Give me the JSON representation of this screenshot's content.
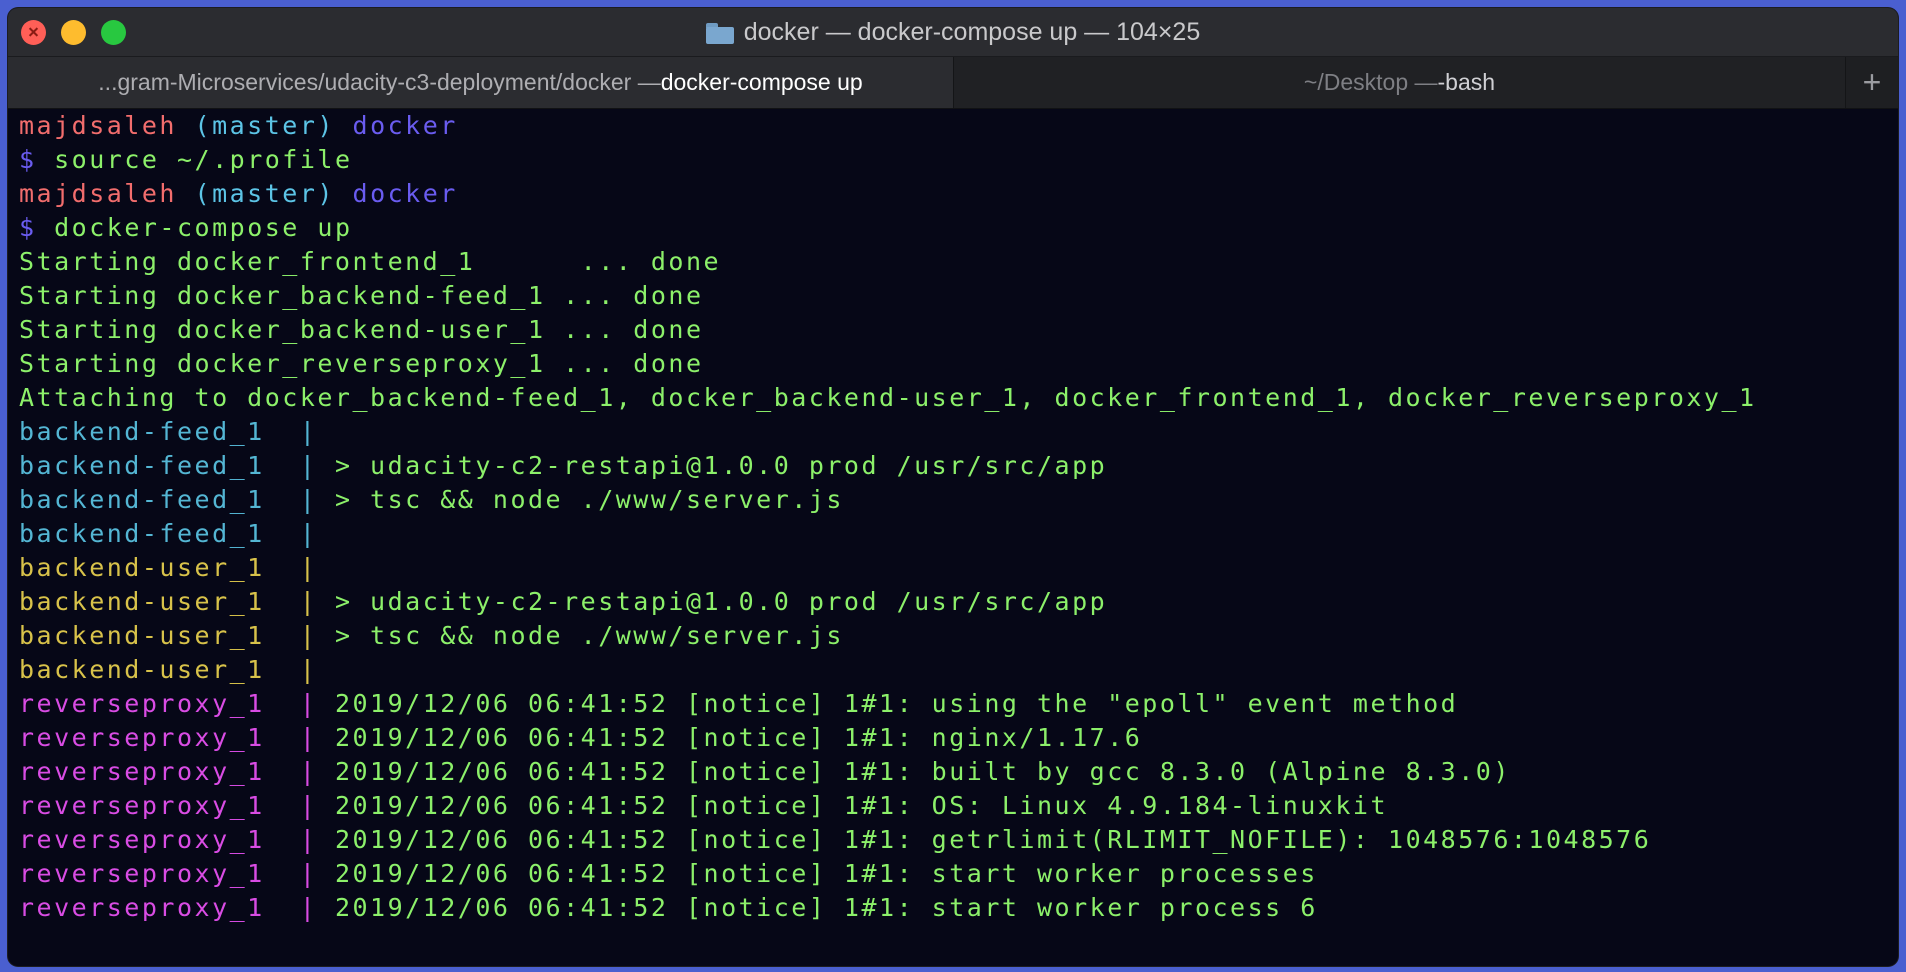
{
  "window": {
    "title": "docker — docker-compose up — 104×25"
  },
  "tabs": [
    {
      "path": "...gram-Microservices/udacity-c3-deployment/docker — ",
      "command": "docker-compose up"
    },
    {
      "path": "~/Desktop — ",
      "command": "-bash"
    }
  ],
  "tab_add_label": "+",
  "prompt": {
    "user": "majdsaleh",
    "branch": "(master)",
    "dir": "docker",
    "symbol": "$"
  },
  "commands": [
    "source ~/.profile",
    "docker-compose up"
  ],
  "starting": [
    "Starting docker_frontend_1      ... done",
    "Starting docker_backend-feed_1 ... done",
    "Starting docker_backend-user_1 ... done",
    "Starting docker_reverseproxy_1 ... done"
  ],
  "attaching": "Attaching to docker_backend-feed_1, docker_backend-user_1, docker_frontend_1, docker_reverseproxy_1",
  "log_lines": [
    {
      "service": "backend-feed_1  ",
      "sep": "| ",
      "text": ""
    },
    {
      "service": "backend-feed_1  ",
      "sep": "| ",
      "text": "> udacity-c2-restapi@1.0.0 prod /usr/src/app"
    },
    {
      "service": "backend-feed_1  ",
      "sep": "| ",
      "text": "> tsc && node ./www/server.js"
    },
    {
      "service": "backend-feed_1  ",
      "sep": "| ",
      "text": ""
    },
    {
      "service": "backend-user_1  ",
      "sep": "| ",
      "text": ""
    },
    {
      "service": "backend-user_1  ",
      "sep": "| ",
      "text": "> udacity-c2-restapi@1.0.0 prod /usr/src/app"
    },
    {
      "service": "backend-user_1  ",
      "sep": "| ",
      "text": "> tsc && node ./www/server.js"
    },
    {
      "service": "backend-user_1  ",
      "sep": "| ",
      "text": ""
    },
    {
      "service": "reverseproxy_1  ",
      "sep": "| ",
      "text": "2019/12/06 06:41:52 [notice] 1#1: using the \"epoll\" event method"
    },
    {
      "service": "reverseproxy_1  ",
      "sep": "| ",
      "text": "2019/12/06 06:41:52 [notice] 1#1: nginx/1.17.6"
    },
    {
      "service": "reverseproxy_1  ",
      "sep": "| ",
      "text": "2019/12/06 06:41:52 [notice] 1#1: built by gcc 8.3.0 (Alpine 8.3.0)"
    },
    {
      "service": "reverseproxy_1  ",
      "sep": "| ",
      "text": "2019/12/06 06:41:52 [notice] 1#1: OS: Linux 4.9.184-linuxkit"
    },
    {
      "service": "reverseproxy_1  ",
      "sep": "| ",
      "text": "2019/12/06 06:41:52 [notice] 1#1: getrlimit(RLIMIT_NOFILE): 1048576:1048576"
    },
    {
      "service": "reverseproxy_1  ",
      "sep": "| ",
      "text": "2019/12/06 06:41:52 [notice] 1#1: start worker processes"
    },
    {
      "service": "reverseproxy_1  ",
      "sep": "| ",
      "text": "2019/12/06 06:41:52 [notice] 1#1: start worker process 6"
    }
  ],
  "colors": {
    "user": "#f26d6d",
    "branch": "#5cc4e6",
    "dir": "#6a5cf0",
    "output": "#8cf06a",
    "service_feed": "#54b6d4",
    "service_user": "#d8c24a",
    "service_proxy": "#d94ce4",
    "background": "#060717"
  }
}
